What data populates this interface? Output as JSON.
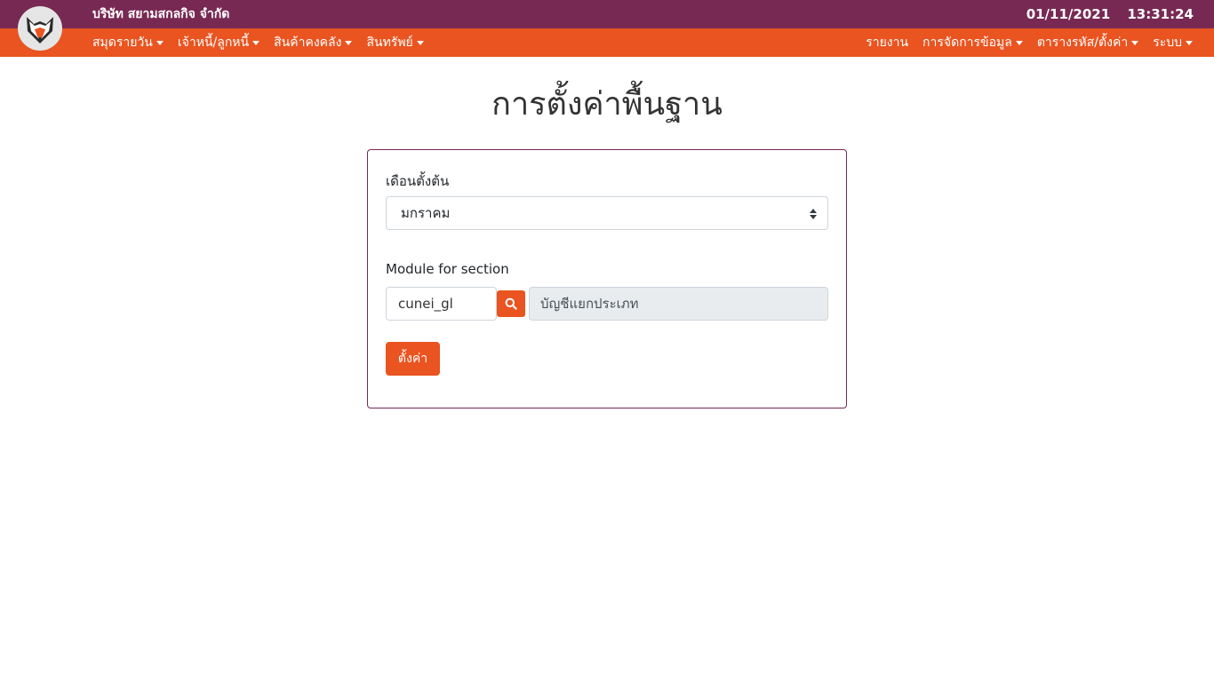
{
  "header": {
    "company": "บริษัท สยามสกลกิจ จำกัด",
    "date": "01/11/2021",
    "time": "13:31:24"
  },
  "nav": {
    "left": [
      {
        "label": "สมุดรายวัน",
        "dropdown": true
      },
      {
        "label": "เจ้าหนี้/ลูกหนี้",
        "dropdown": true
      },
      {
        "label": "สินค้าคงคลัง",
        "dropdown": true
      },
      {
        "label": "สินทรัพย์",
        "dropdown": true
      }
    ],
    "right": [
      {
        "label": "รายงาน",
        "dropdown": false
      },
      {
        "label": "การจัดการข้อมูล",
        "dropdown": true
      },
      {
        "label": "ตารางรหัส/ตั้งค่า",
        "dropdown": true
      },
      {
        "label": "ระบบ",
        "dropdown": true
      }
    ]
  },
  "page": {
    "title": "การตั้งค่าพื้นฐาน"
  },
  "form": {
    "month_label": "เดือนตั้งต้น",
    "month_value": "มกราคม",
    "module_label": "Module for section",
    "module_code": "cunei_gl",
    "module_name": "บัญชีแยกประเภท",
    "submit_label": "ตั้งค่า"
  },
  "colors": {
    "topbar": "#772953",
    "navbar": "#E95420",
    "accent": "#E95420"
  },
  "icons": {
    "logo": "fox-logo-icon",
    "search": "search-icon"
  }
}
